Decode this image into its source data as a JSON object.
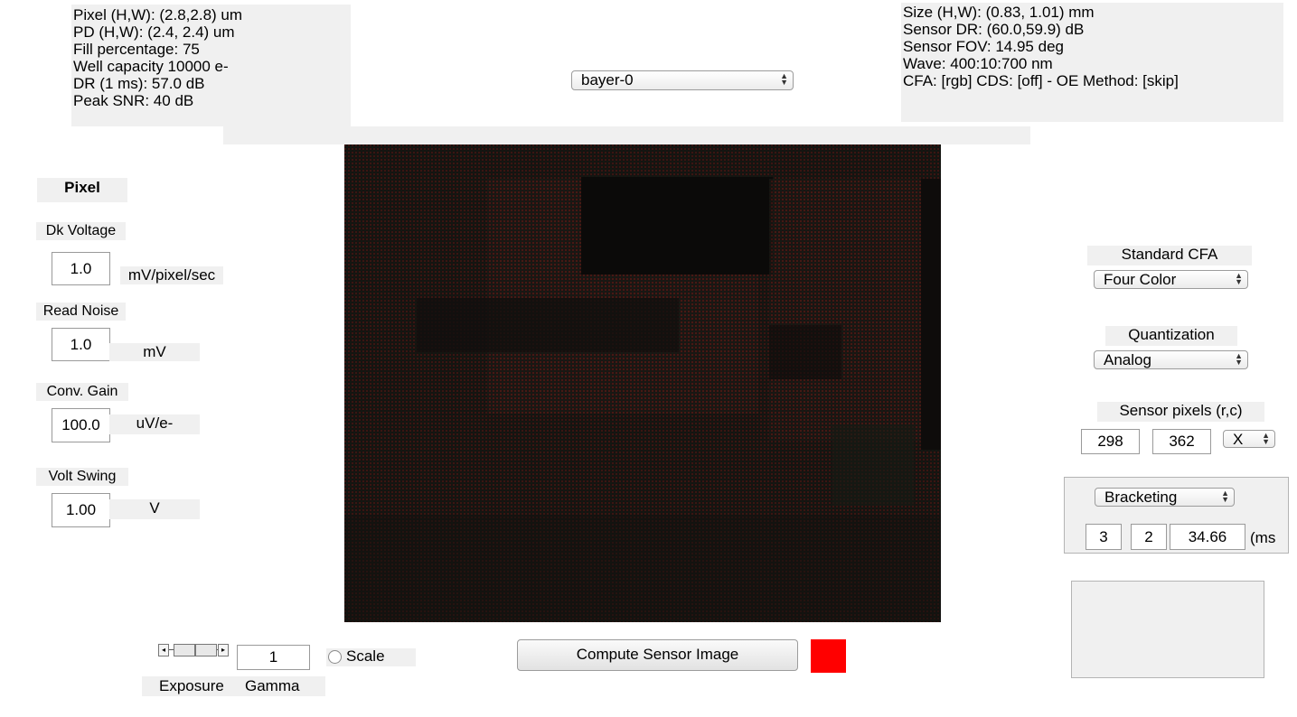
{
  "pixel_info": [
    "Pixel (H,W): (2.8,2.8) um",
    "PD (H,W): (2.4, 2.4) um",
    "Fill percentage: 75",
    "Well capacity 10000 e-",
    "DR (1 ms): 57.0 dB",
    "Peak SNR: 40 dB"
  ],
  "sensor_info": [
    "Size (H,W): (0.83, 1.01) mm",
    "Sensor DR:  (60.0,59.9) dB",
    "Sensor FOV: 14.95 deg",
    "Wave:  400:10:700 nm",
    "CFA:  [rgb] CDS: [off] - OE Method: [skip]"
  ],
  "sensor_select": {
    "value": "bayer-0"
  },
  "left_panel": {
    "title": "Pixel",
    "dark_voltage": {
      "label": "Dk Voltage",
      "value": "1.0",
      "unit": "mV/pixel/sec"
    },
    "read_noise": {
      "label": "Read Noise",
      "value": "1.0",
      "unit": "mV"
    },
    "conv_gain": {
      "label": "Conv. Gain",
      "value": "100.0",
      "unit": "uV/e-"
    },
    "volt_swing": {
      "label": "Volt Swing",
      "value": "1.00",
      "unit": "V"
    }
  },
  "right_panel": {
    "cfa": {
      "label": "Standard CFA",
      "value": "Four Color"
    },
    "quantization": {
      "label": "Quantization",
      "value": "Analog"
    },
    "sensor_pixels": {
      "label": "Sensor pixels  (r,c)",
      "rows": "298",
      "cols": "362",
      "mode": "X"
    },
    "exposure": {
      "mode": "Bracketing",
      "n": "3",
      "step": "2",
      "time": "34.66",
      "unit": "(ms"
    }
  },
  "bottom": {
    "gamma_value": "1",
    "scale_label": "Scale",
    "exposure_label": "Exposure",
    "gamma_label": "Gamma",
    "compute_button": "Compute Sensor  Image",
    "indicator_color": "#ff0000"
  },
  "image": {
    "description_icon": "sensor-mosaic-image"
  }
}
